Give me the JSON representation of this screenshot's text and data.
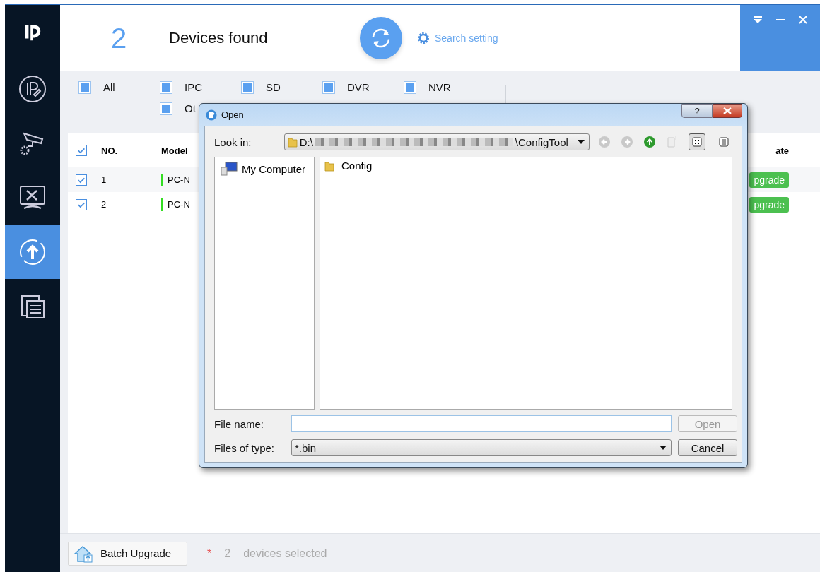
{
  "sidebar": {
    "items": [
      {
        "kind": "ip",
        "selected": false
      },
      {
        "kind": "camera",
        "selected": false
      },
      {
        "kind": "tools",
        "selected": false
      },
      {
        "kind": "upgrade",
        "selected": true
      },
      {
        "kind": "log",
        "selected": false
      }
    ]
  },
  "header": {
    "count": "2",
    "title": "Devices found",
    "search_setting": "Search setting"
  },
  "filters": [
    {
      "label": "All",
      "checked": true
    },
    {
      "label": "IPC",
      "checked": true
    },
    {
      "label": "SD",
      "checked": true
    },
    {
      "label": "DVR",
      "checked": true
    },
    {
      "label": "NVR",
      "checked": true
    },
    {
      "label": "Ot",
      "checked": true
    }
  ],
  "table": {
    "header_checked": true,
    "columns": [
      "NO.",
      "Model",
      "ate"
    ],
    "rows": [
      {
        "checked": true,
        "no": "1",
        "color": "#33dd22",
        "model": "PC-N",
        "action": "pgrade"
      },
      {
        "checked": true,
        "no": "2",
        "color": "#33dd22",
        "model": "PC-N",
        "action": "pgrade"
      }
    ]
  },
  "dialog": {
    "title": "Open",
    "help": "?",
    "look_in_label": "Look in:",
    "path_start": "D:\\",
    "path_end": "\\ConfigTool",
    "places": [
      {
        "label": "My Computer"
      }
    ],
    "files": [
      {
        "name": "Config"
      }
    ],
    "file_name_label": "File name:",
    "files_of_type_label": "Files of type:",
    "files_of_type": "*.bin",
    "buttons": [
      {
        "label": "Open",
        "disabled": true
      },
      {
        "label": "Cancel",
        "disabled": false
      }
    ]
  },
  "footer": {
    "batch_upgrade": "Batch Upgrade",
    "required_mark": "*",
    "selected_count": "2",
    "selected_text": "devices selected"
  }
}
